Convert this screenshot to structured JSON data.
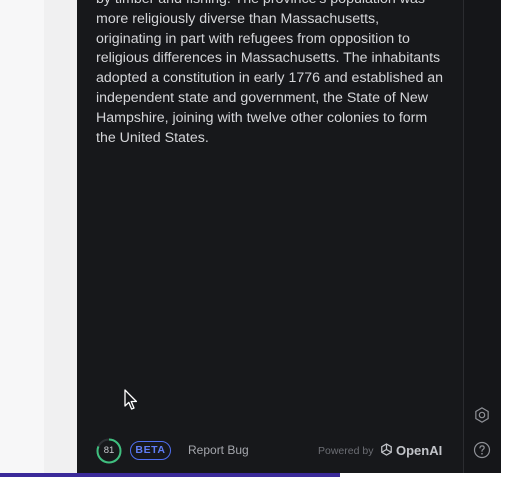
{
  "article": {
    "text": "by timber and fishing. The province's population was more religiously diverse than Massachusetts, originating in part with refugees from opposition to religious differences in Massachusetts. The inhabitants adopted a constitution in early 1776 and established an independent state and government, the State of New Hampshire, joining with twelve other colonies to form the United States."
  },
  "footer": {
    "score": "81",
    "beta_label": "BETA",
    "report_bug": "Report Bug",
    "powered_by": "Powered by",
    "brand": "OpenAI"
  },
  "icons": {
    "settings": "gear-icon",
    "help": "question-circle-icon",
    "cursor": "mouse-pointer-icon",
    "brand_logo": "openai-logo-icon"
  },
  "colors": {
    "panel_bg": "#17181b",
    "accent_blue": "#4f6ef0",
    "score_ring": "#3fbf7f",
    "bottom_bar": "#3b2a9a"
  }
}
